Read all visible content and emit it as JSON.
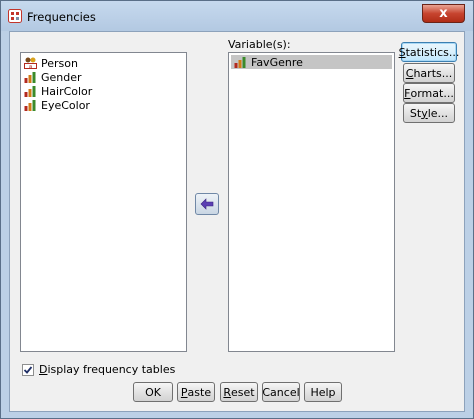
{
  "window": {
    "title": "Frequencies",
    "close_glyph": "x"
  },
  "source_list": {
    "items": [
      {
        "label": "Person",
        "icon": "nominal-string-icon"
      },
      {
        "label": "Gender",
        "icon": "ordinal-scale-icon"
      },
      {
        "label": "HairColor",
        "icon": "ordinal-scale-icon"
      },
      {
        "label": "EyeColor",
        "icon": "ordinal-scale-icon"
      }
    ]
  },
  "target": {
    "label": "Variable(s):",
    "items": [
      {
        "label": "FavGenre",
        "icon": "ordinal-scale-icon",
        "selected": true
      }
    ]
  },
  "side_buttons": {
    "statistics": {
      "ul": "S",
      "rest": "tatistics..."
    },
    "charts": {
      "ul": "C",
      "rest": "harts..."
    },
    "format": {
      "ul": "F",
      "rest": "ormat..."
    },
    "style": {
      "pre": "St",
      "ul": "y",
      "rest": "le..."
    }
  },
  "display_tables": {
    "pre": "",
    "ul": "D",
    "rest": "isplay frequency tables",
    "checked": true
  },
  "bottom_buttons": {
    "ok": {
      "label": "OK"
    },
    "paste": {
      "ul": "P",
      "rest": "aste"
    },
    "reset": {
      "ul": "R",
      "rest": "eset"
    },
    "cancel": {
      "label": "Cancel"
    },
    "help": {
      "label": "Help"
    }
  },
  "colors": {
    "frame": "#bcd0e6",
    "dialog_bg": "#f0f0f0",
    "close_red": "#c7442f",
    "arrow_purple": "#5b3fb3",
    "selection": "#c5c5c5"
  }
}
